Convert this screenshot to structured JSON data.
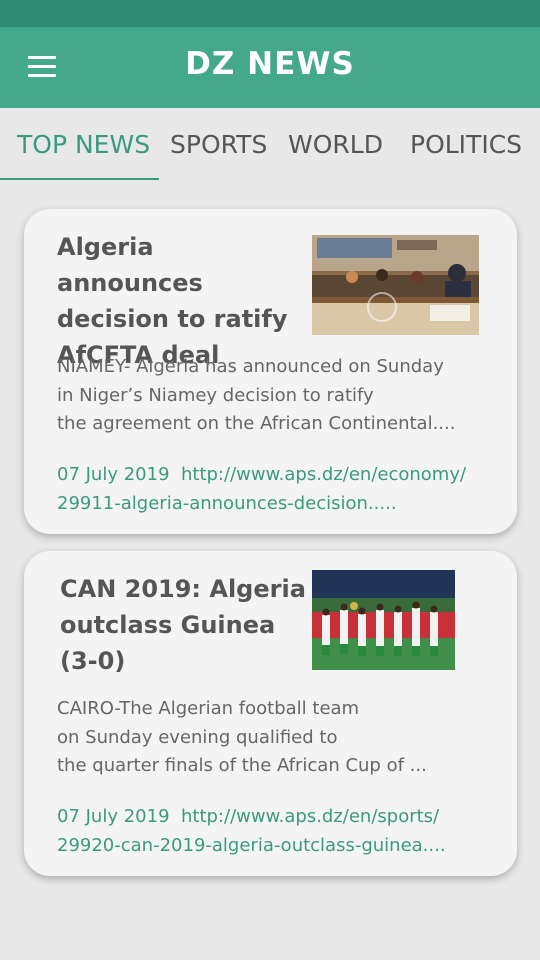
{
  "app": {
    "title": "DZ NEWS"
  },
  "tabs": [
    {
      "label": "TOP NEWS",
      "active": true
    },
    {
      "label": "SPORTS",
      "active": false
    },
    {
      "label": "WORLD",
      "active": false
    },
    {
      "label": "POLITICS",
      "active": false
    }
  ],
  "articles": [
    {
      "title_lines": [
        "Algeria announces",
        "decision to ratify",
        "AfCFTA deal"
      ],
      "summary": "NIAMEY- Algeria has announced on Sunday\nin Niger’s Niamey decision to ratify\nthe agreement on the African Continental....",
      "date": "07 July 2019",
      "url_line1": "http://www.aps.dz/en/economy/",
      "url_line2": "29911-algeria-announces-decision.....",
      "image_icon": "conference-photo"
    },
    {
      "title_lines": [
        "CAN 2019: Algeria",
        "outclass Guinea",
        "(3-0)"
      ],
      "summary": "CAIRO-The Algerian football team\n on Sunday evening qualified to\nthe quarter finals of the African Cup of ...",
      "date": "07 July 2019",
      "url_line1": "http://www.aps.dz/en/sports/",
      "url_line2": "29920-can-2019-algeria-outclass-guinea....",
      "image_icon": "football-team-photo"
    }
  ],
  "colors": {
    "status_bar": "#2e8a72",
    "app_bar": "#44a88b",
    "accent": "#3a9a80",
    "background": "#e8e8e8",
    "card": "#f4f4f4"
  }
}
